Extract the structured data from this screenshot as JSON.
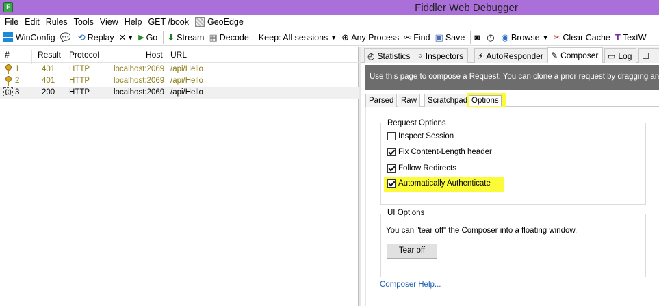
{
  "window": {
    "title": "Fiddler Web Debugger",
    "app_icon": "fiddler-icon"
  },
  "menu": [
    "File",
    "Edit",
    "Rules",
    "Tools",
    "View",
    "Help",
    "GET /book",
    "GeoEdge"
  ],
  "toolbar": {
    "winconfig": "WinConfig",
    "replay": "Replay",
    "remove": "✕",
    "go": "Go",
    "stream": "Stream",
    "decode": "Decode",
    "keep": "Keep: All sessions",
    "any_process": "Any Process",
    "find": "Find",
    "save": "Save",
    "browse": "Browse",
    "clear_cache": "Clear Cache",
    "textwizard": "TextW"
  },
  "sessions": {
    "columns": [
      "#",
      "Result",
      "Protocol",
      "Host",
      "URL"
    ],
    "rows": [
      {
        "num": "1",
        "result": "401",
        "protocol": "HTTP",
        "host": "localhost:2069",
        "url": "/api/Hello"
      },
      {
        "num": "2",
        "result": "401",
        "protocol": "HTTP",
        "host": "localhost:2069",
        "url": "/api/Hello"
      },
      {
        "num": "3",
        "result": "200",
        "protocol": "HTTP",
        "host": "localhost:2069",
        "url": "/api/Hello"
      }
    ]
  },
  "inspector_tabs": [
    "Statistics",
    "Inspectors",
    "AutoResponder",
    "Composer",
    "Log",
    ""
  ],
  "composer": {
    "banner": "Use this page to compose a Request. You can clone a prior request by dragging and d",
    "subtabs": [
      "Parsed",
      "Raw",
      "Scratchpad",
      "Options"
    ],
    "request_options": {
      "title": "Request Options",
      "inspect_session": "Inspect Session",
      "fix_content_length": "Fix Content-Length header",
      "follow_redirects": "Follow Redirects",
      "auto_authenticate": "Automatically Authenticate",
      "checked": [
        false,
        true,
        true,
        true
      ]
    },
    "ui_options": {
      "title": "UI Options",
      "description": "You can \"tear off\" the Composer into a floating window.",
      "tear_off": "Tear off"
    },
    "help_link": "Composer Help..."
  },
  "highlight_color": "#fbfb3a",
  "titlebar_color": "#ab6fd9"
}
